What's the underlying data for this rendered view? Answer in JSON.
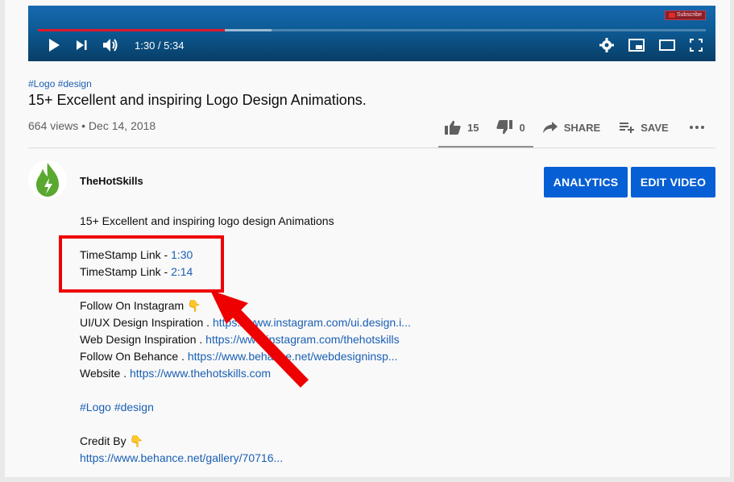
{
  "player": {
    "time": "1:30 / 5:34",
    "progress_played": 0.28,
    "progress_buffered": 0.35,
    "subscribe_badge": "Subscribe"
  },
  "video": {
    "tags": "#Logo #design",
    "title": "15+ Excellent and inspiring Logo Design Animations.",
    "meta": "664 views • Dec 14, 2018"
  },
  "actions": {
    "likes": "15",
    "dislikes": "0",
    "share": "SHARE",
    "save": "SAVE"
  },
  "channel": {
    "name": "TheHotSkills"
  },
  "buttons": {
    "analytics": "ANALYTICS",
    "edit": "EDIT VIDEO"
  },
  "description": {
    "intro": "15+ Excellent and inspiring logo design Animations",
    "timestamp_label": "TimeStamp Link - ",
    "timestamp1": "1:30",
    "timestamp2": "2:14",
    "follow_instagram": "Follow On Instagram 👇",
    "uiux_label": "UI/UX Design Inspiration . ",
    "uiux_link": "https://www.instagram.com/ui.design.i...",
    "web_label": "Web Design Inspiration . ",
    "web_link": "https://www.instagram.com/thehotskills",
    "behance_label": "Follow On Behance . ",
    "behance_link": "https://www.behance.net/webdesigninsp...",
    "website_label": "Website . ",
    "website_link": "https://www.thehotskills.com",
    "hashtags": "#Logo #design",
    "credit": "Credit By 👇",
    "credit_link": "https://www.behance.net/gallery/70716..."
  },
  "colors": {
    "accent_blue": "#065fd4",
    "link_blue": "#1a5fb4",
    "highlight_red": "#ee0000",
    "progress_red": "#e0182b"
  }
}
